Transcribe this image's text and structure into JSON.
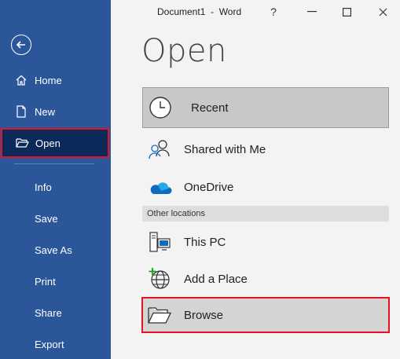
{
  "window": {
    "title": "Document1  -  Word",
    "help": "?",
    "minimize": "—",
    "maximize": "☐",
    "close": "✕"
  },
  "sidebar": {
    "items": [
      {
        "label": "Home",
        "icon": "home-icon"
      },
      {
        "label": "New",
        "icon": "new-document-icon"
      },
      {
        "label": "Open",
        "icon": "open-folder-icon",
        "active": true
      },
      {
        "label": "Info"
      },
      {
        "label": "Save"
      },
      {
        "label": "Save As"
      },
      {
        "label": "Print"
      },
      {
        "label": "Share"
      },
      {
        "label": "Export"
      }
    ]
  },
  "main": {
    "title": "Open",
    "locations": [
      {
        "label": "Recent",
        "icon": "clock-icon",
        "selected": true
      },
      {
        "label": "Shared with Me",
        "icon": "people-icon"
      },
      {
        "label": "OneDrive",
        "icon": "cloud-icon"
      }
    ],
    "other_locations_header": "Other locations",
    "other_locations": [
      {
        "label": "This PC",
        "icon": "computer-icon"
      },
      {
        "label": "Add a Place",
        "icon": "globe-add-icon"
      },
      {
        "label": "Browse",
        "icon": "folder-icon",
        "highlighted": true
      }
    ]
  },
  "colors": {
    "sidebar": "#2b579a",
    "sidebar_active": "#0b2a5a",
    "highlight_border": "#e81123",
    "onedrive_blue": "#0f6cbd"
  }
}
